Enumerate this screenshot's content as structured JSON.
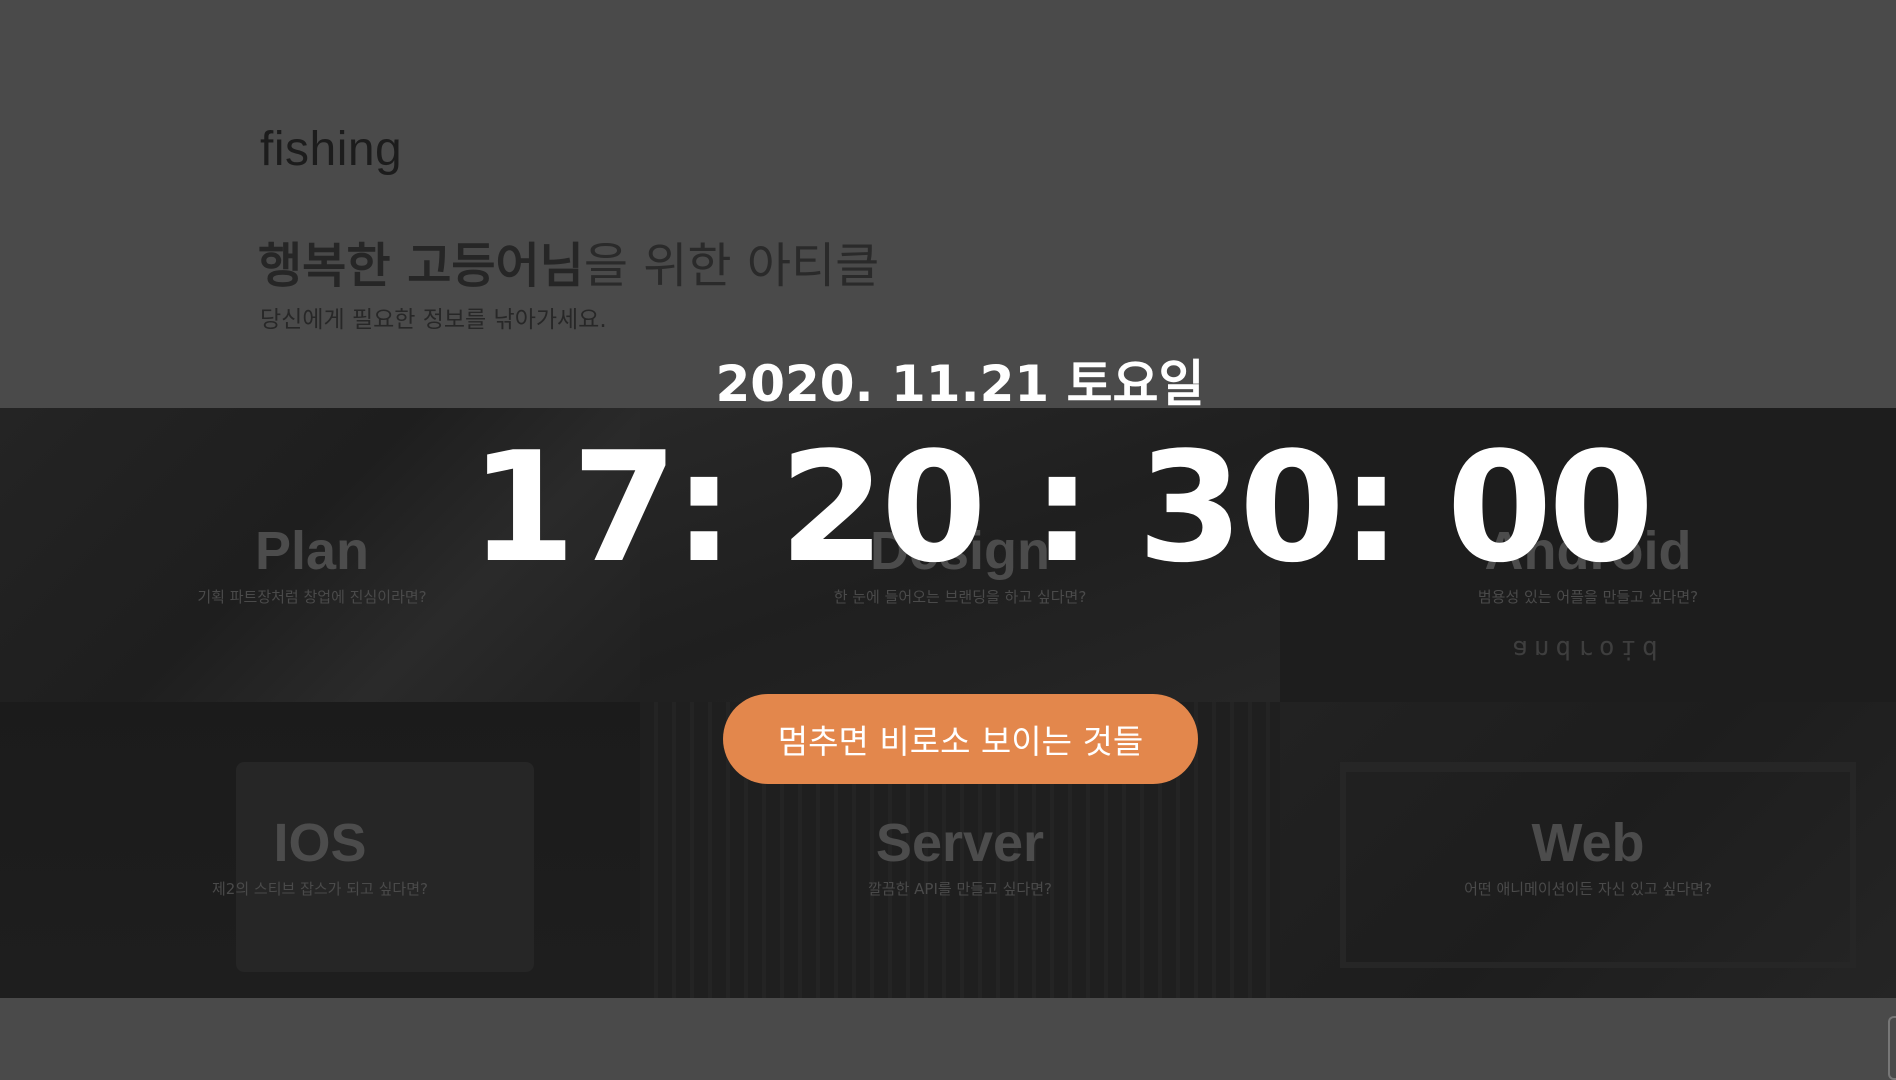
{
  "header": {
    "logo": "fishing",
    "headline_bold": "행복한 고등어님",
    "headline_rest": "을 위한 아티클",
    "subline": "당신에게 필요한 정보를 낚아가세요."
  },
  "overlay": {
    "date": "2020. 11.21 토요일",
    "clock": "17: 20 : 30: 00",
    "button_label": "멈추면 비로소 보이는 것들"
  },
  "categories": [
    {
      "name": "Plan",
      "desc": "기획 파트장처럼 창업에 진심이라면?"
    },
    {
      "name": "Design",
      "desc": "한 눈에 들어오는 브랜딩을 하고 싶다면?"
    },
    {
      "name": "Android",
      "desc": "범용성 있는 어플을 만들고 싶다면?",
      "logo_text": "android"
    },
    {
      "name": "IOS",
      "desc": "제2의 스티브 잡스가 되고 싶다면?"
    },
    {
      "name": "Server",
      "desc": "깔끔한 API를 만들고 싶다면?"
    },
    {
      "name": "Web",
      "desc": "어떤 애니메이션이든 자신 있고 싶다면?"
    }
  ],
  "colors": {
    "page_background": "#4a4a4a",
    "button_accent": "#e3874c",
    "clock_text": "#ffffff"
  }
}
